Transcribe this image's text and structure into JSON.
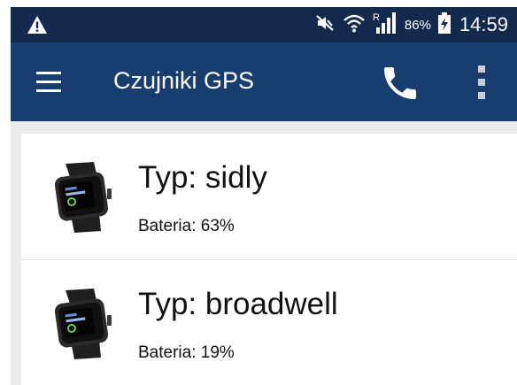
{
  "status_bar": {
    "battery_percent": "86%",
    "time": "14:59",
    "icons": [
      "warning-icon",
      "mute-icon",
      "wifi-icon",
      "signal-roaming-icon",
      "battery-charging-icon"
    ]
  },
  "app_bar": {
    "title": "Czujniki GPS",
    "icons": [
      "menu-icon",
      "phone-icon",
      "overflow-menu-icon"
    ]
  },
  "devices": [
    {
      "title": "Typ: sidly",
      "battery": "Bateria: 63%",
      "icon": "smartwatch-icon"
    },
    {
      "title": "Typ: broadwell",
      "battery": "Bateria: 19%",
      "icon": "smartwatch-icon"
    }
  ],
  "colors": {
    "status_bar": "#112a4d",
    "app_bar": "#183e70",
    "background": "#ebebeb",
    "card": "#ffffff",
    "text": "#111111"
  }
}
